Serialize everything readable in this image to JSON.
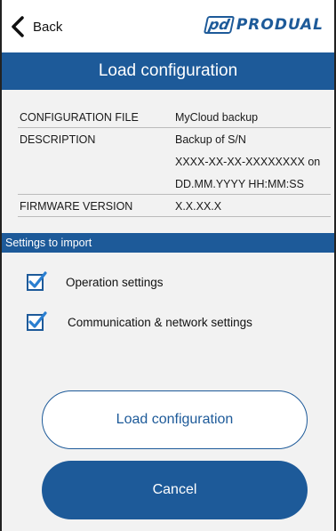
{
  "topbar": {
    "back_label": "Back",
    "logo_mark": "pd",
    "logo_text": "PRODUAL"
  },
  "title": "Load configuration",
  "info": {
    "config_file_label": "CONFIGURATION FILE",
    "config_file_value": "MyCloud backup",
    "description_label": "DESCRIPTION",
    "description_line1": "Backup of S/N",
    "description_line2": "XXXX-XX-XX-XXXXXXXX on",
    "description_line3": "DD.MM.YYYY  HH:MM:SS",
    "firmware_label": "FIRMWARE VERSION",
    "firmware_value": "X.X.XX.X"
  },
  "settings": {
    "header": "Settings to import",
    "items": [
      {
        "label": "Operation settings",
        "checked": true
      },
      {
        "label": "Communication & network settings",
        "checked": true
      }
    ]
  },
  "buttons": {
    "load": "Load configuration",
    "cancel": "Cancel"
  },
  "colors": {
    "primary": "#1d5a99",
    "background": "#f2f2f2"
  }
}
